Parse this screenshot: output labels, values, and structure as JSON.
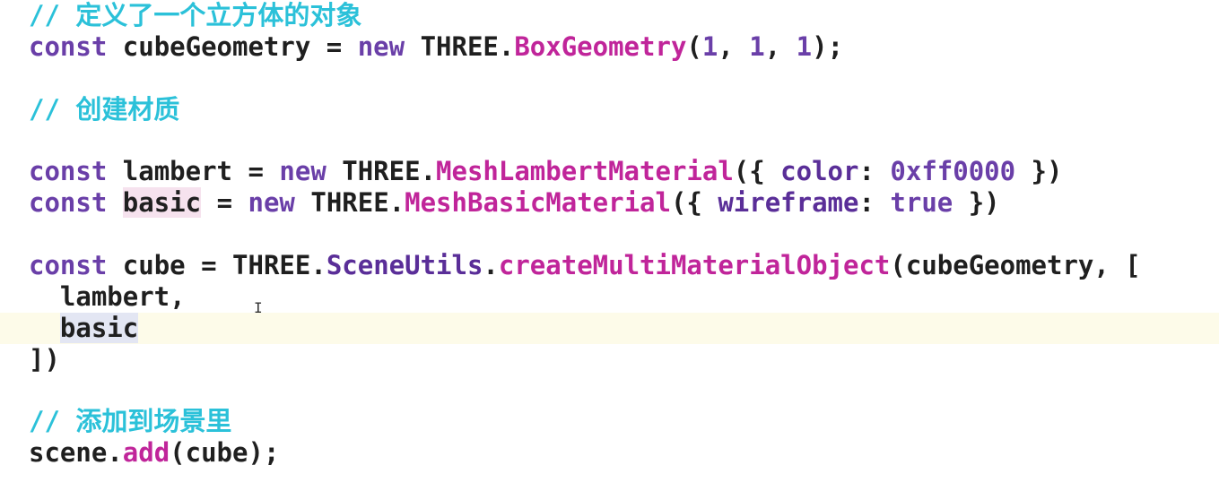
{
  "editor": {
    "lines": [
      {
        "comment": "// 定义了一个立方体的对象"
      },
      {
        "kw1": "const",
        "name": "cubeGeometry",
        "eq": "=",
        "kw2": "new",
        "obj": "THREE",
        "dot": ".",
        "fn": "BoxGeometry",
        "args_open": "(",
        "n1": "1",
        "c1": ", ",
        "n2": "1",
        "c2": ", ",
        "n3": "1",
        "args_close": ");"
      },
      {
        "comment": "// 创建材质"
      },
      {
        "kw1": "const",
        "name": "lambert",
        "eq": "=",
        "kw2": "new",
        "obj": "THREE",
        "dot": ".",
        "fn": "MeshLambertMaterial",
        "open": "({ ",
        "prop": "color",
        "colon": ": ",
        "val": "0xff0000",
        "close": " })"
      },
      {
        "kw1": "const",
        "name": "basic",
        "eq": "=",
        "kw2": "new",
        "obj": "THREE",
        "dot": ".",
        "fn": "MeshBasicMaterial",
        "open": "({ ",
        "prop": "wireframe",
        "colon": ": ",
        "val": "true",
        "close": " })"
      },
      {
        "kw1": "const",
        "name": "cube",
        "eq": "=",
        "obj": "THREE",
        "dot1": ".",
        "obj2": "SceneUtils",
        "dot2": ".",
        "fn": "createMultiMaterialObject",
        "open": "(",
        "arg": "cubeGeometry",
        "rest": ", ["
      },
      {
        "text": "  lambert,"
      },
      {
        "indent": "  ",
        "text": "basic"
      },
      {
        "text": "])"
      },
      {
        "comment": "// 添加到场景里"
      },
      {
        "obj": "scene",
        "dot": ".",
        "fn": "add",
        "open": "(",
        "arg": "cube",
        "close": ");"
      }
    ],
    "cursor_glyph": "I"
  }
}
